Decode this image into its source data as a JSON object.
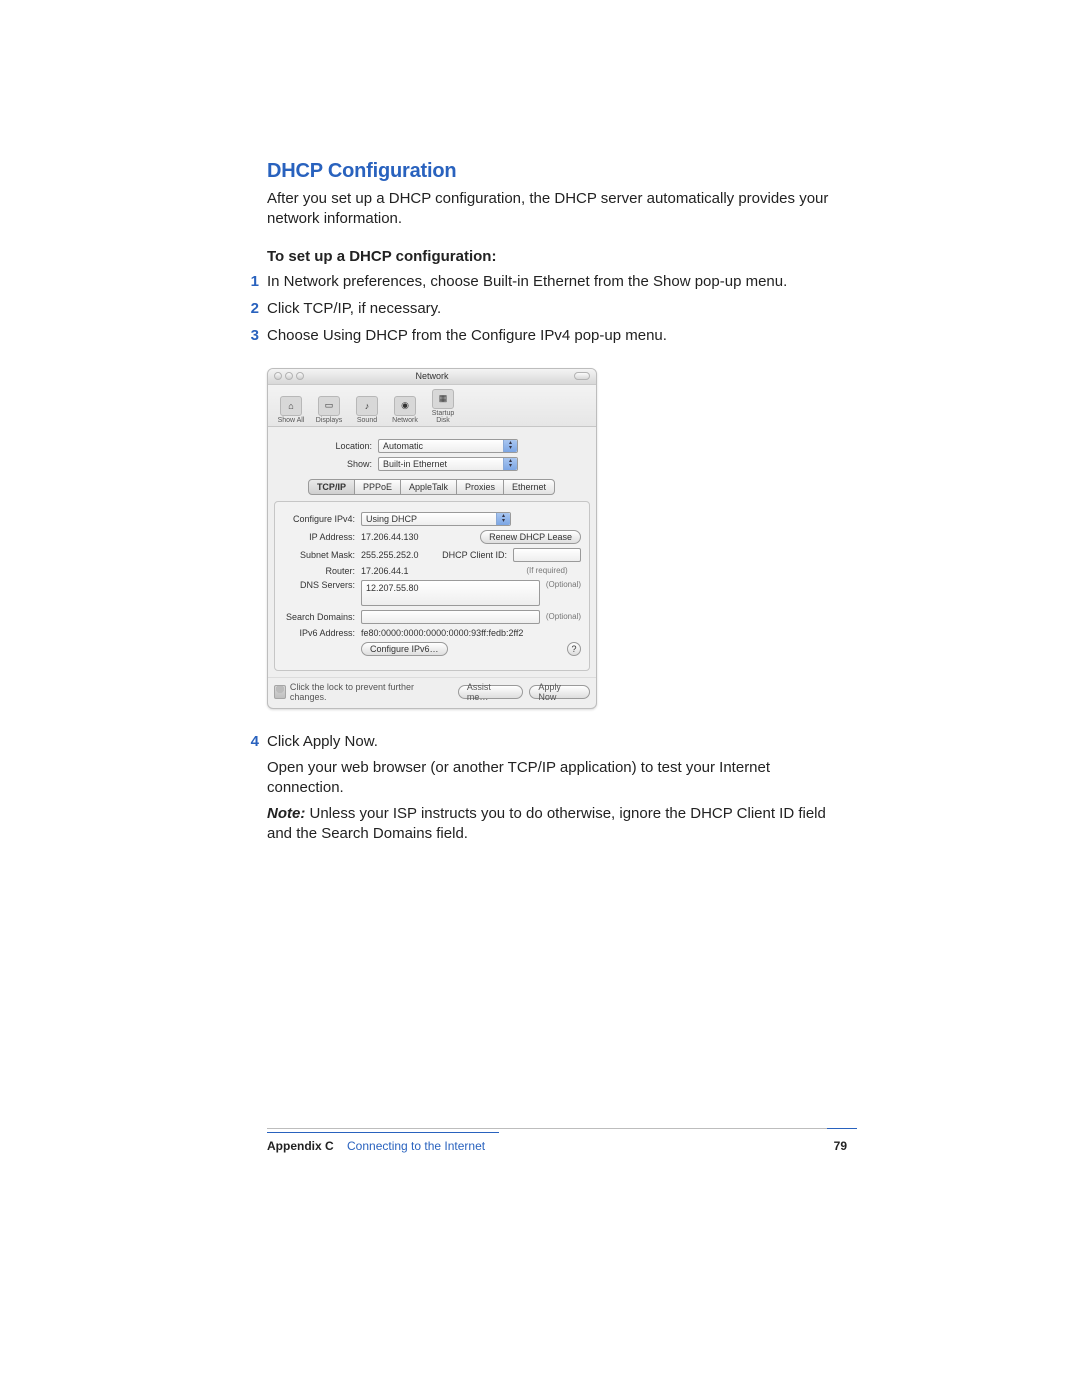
{
  "section": {
    "title": "DHCP Configuration",
    "intro": "After you set up a DHCP configuration, the DHCP server automatically provides your network information.",
    "subhead": "To set up a DHCP configuration:",
    "steps": [
      "In Network preferences, choose Built-in Ethernet from the Show pop-up menu.",
      "Click TCP/IP, if necessary.",
      "Choose Using DHCP from the Configure IPv4 pop-up menu."
    ],
    "step4": "Click Apply Now.",
    "after4a": "Open your web browser (or another TCP/IP application) to test your Internet connection.",
    "note_label": "Note:",
    "note_body": "Unless your ISP instructs you to do otherwise, ignore the DHCP Client ID field and the Search Domains field."
  },
  "prefwin": {
    "title": "Network",
    "toolbar": {
      "show_all": "Show All",
      "displays": "Displays",
      "sound": "Sound",
      "network": "Network",
      "startup": "Startup Disk"
    },
    "location_label": "Location:",
    "location_value": "Automatic",
    "show_label": "Show:",
    "show_value": "Built-in Ethernet",
    "tabs": [
      "TCP/IP",
      "PPPoE",
      "AppleTalk",
      "Proxies",
      "Ethernet"
    ],
    "configure_label": "Configure IPv4:",
    "configure_value": "Using DHCP",
    "ip_label": "IP Address:",
    "ip_value": "17.206.44.130",
    "renew_btn": "Renew DHCP Lease",
    "subnet_label": "Subnet Mask:",
    "subnet_value": "255.255.252.0",
    "dhcp_client_label": "DHCP Client ID:",
    "dhcp_client_hint": "(If required)",
    "router_label": "Router:",
    "router_value": "17.206.44.1",
    "dns_label": "DNS Servers:",
    "dns_value": "12.207.55.80",
    "optional": "(Optional)",
    "search_label": "Search Domains:",
    "ipv6_label": "IPv6 Address:",
    "ipv6_value": "fe80:0000:0000:0000:0000:93ff:fedb:2ff2",
    "conf_ipv6_btn": "Configure IPv6…",
    "lock_text": "Click the lock to prevent further changes.",
    "assist_btn": "Assist me…",
    "apply_btn": "Apply Now",
    "help": "?"
  },
  "footer": {
    "appendix": "Appendix C",
    "chapter": "Connecting to the Internet",
    "page": "79"
  }
}
